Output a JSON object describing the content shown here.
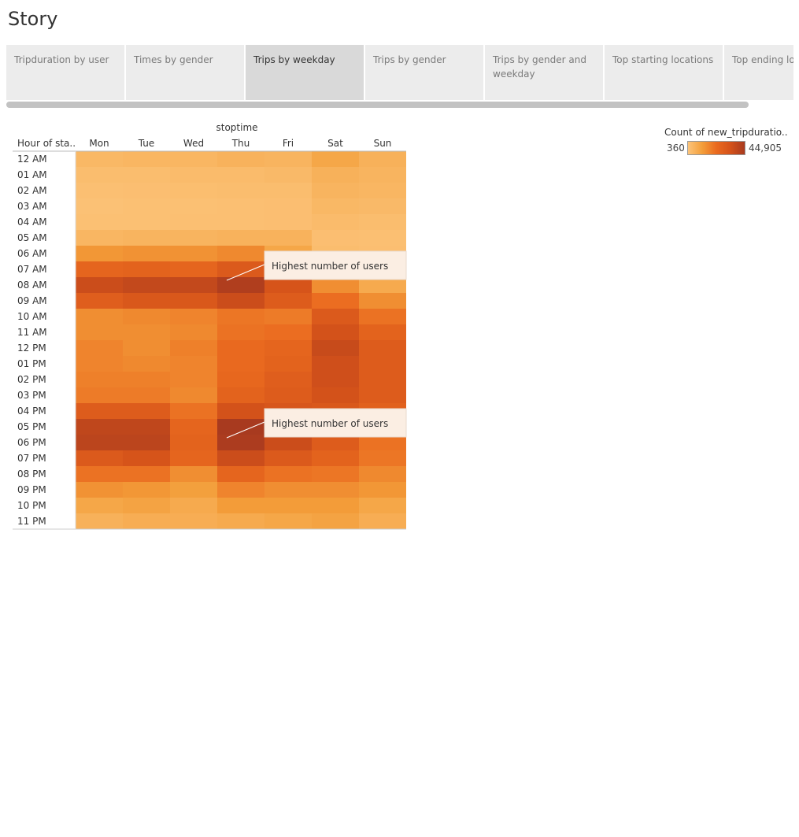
{
  "story": {
    "title": "Story"
  },
  "nav": {
    "tabs": [
      {
        "label": "Tripduration by user",
        "active": false
      },
      {
        "label": "Times by gender",
        "active": false
      },
      {
        "label": "Trips by weekday",
        "active": true
      },
      {
        "label": "Trips by gender",
        "active": false
      },
      {
        "label": "Trips by gender and weekday",
        "active": false
      },
      {
        "label": "Top starting locations",
        "active": false
      },
      {
        "label": "Top ending location",
        "active": false
      }
    ]
  },
  "legend": {
    "title": "Count of new_tripduratio..",
    "min_label": "360",
    "max_label": "44,905",
    "colors": [
      "#fcc47a",
      "#f39e3a",
      "#ea6a1f",
      "#d4521a",
      "#a83a1f"
    ]
  },
  "annotations": [
    {
      "text": "Highest number of users",
      "target": {
        "row": "08 AM",
        "col": "Thu"
      }
    },
    {
      "text": "Highest number of users",
      "target": {
        "row": "06 PM",
        "col": "Thu"
      }
    }
  ],
  "chart_data": {
    "type": "heatmap",
    "title": "",
    "column_header": "stoptime",
    "row_header": "Hour of sta..",
    "columns": [
      "Mon",
      "Tue",
      "Wed",
      "Thu",
      "Fri",
      "Sat",
      "Sun"
    ],
    "rows": [
      "12 AM",
      "01 AM",
      "02 AM",
      "03 AM",
      "04 AM",
      "05 AM",
      "06 AM",
      "07 AM",
      "08 AM",
      "09 AM",
      "10 AM",
      "11 AM",
      "12 PM",
      "01 PM",
      "02 PM",
      "03 PM",
      "04 PM",
      "05 PM",
      "06 PM",
      "07 PM",
      "08 PM",
      "09 PM",
      "10 PM",
      "11 PM"
    ],
    "color_range": [
      360,
      44905
    ],
    "values": [
      [
        4000,
        4500,
        4500,
        5500,
        5000,
        9000,
        6000
      ],
      [
        2500,
        2500,
        3000,
        3000,
        3500,
        6000,
        5000
      ],
      [
        1800,
        2000,
        2200,
        2500,
        2500,
        5000,
        4500
      ],
      [
        1200,
        1500,
        1500,
        1800,
        2000,
        4000,
        3500
      ],
      [
        1500,
        1500,
        1800,
        1800,
        2000,
        3000,
        2500
      ],
      [
        4500,
        5000,
        5000,
        5500,
        5500,
        2000,
        1800
      ],
      [
        13000,
        14000,
        14000,
        16000,
        9000,
        2500,
        2000
      ],
      [
        25000,
        26000,
        25000,
        30000,
        14000,
        5000,
        3500
      ],
      [
        36000,
        38000,
        38000,
        43000,
        33000,
        15000,
        8000
      ],
      [
        28000,
        31000,
        31000,
        36000,
        29000,
        22000,
        15000
      ],
      [
        15000,
        16000,
        17000,
        20000,
        19000,
        30000,
        21000
      ],
      [
        15000,
        15000,
        16000,
        21000,
        22000,
        34000,
        26000
      ],
      [
        17000,
        15000,
        18000,
        23000,
        25000,
        37000,
        29000
      ],
      [
        17000,
        16000,
        17000,
        23000,
        26000,
        35000,
        29000
      ],
      [
        18000,
        18000,
        17000,
        24000,
        28000,
        35000,
        29000
      ],
      [
        19000,
        19000,
        16000,
        26000,
        29000,
        34000,
        29000
      ],
      [
        29000,
        29000,
        21000,
        34000,
        32000,
        31000,
        27000
      ],
      [
        39000,
        39000,
        25000,
        44905,
        33000,
        29000,
        24000
      ],
      [
        40000,
        40000,
        26000,
        44000,
        36000,
        29000,
        21000
      ],
      [
        30000,
        33000,
        25000,
        36000,
        30000,
        26000,
        20000
      ],
      [
        21000,
        21000,
        15000,
        25000,
        21000,
        20000,
        16000
      ],
      [
        14000,
        13000,
        11000,
        17000,
        15000,
        15000,
        13000
      ],
      [
        9000,
        10000,
        8000,
        12000,
        12000,
        12000,
        9000
      ],
      [
        6000,
        7000,
        7000,
        8000,
        9000,
        10000,
        7000
      ]
    ]
  }
}
